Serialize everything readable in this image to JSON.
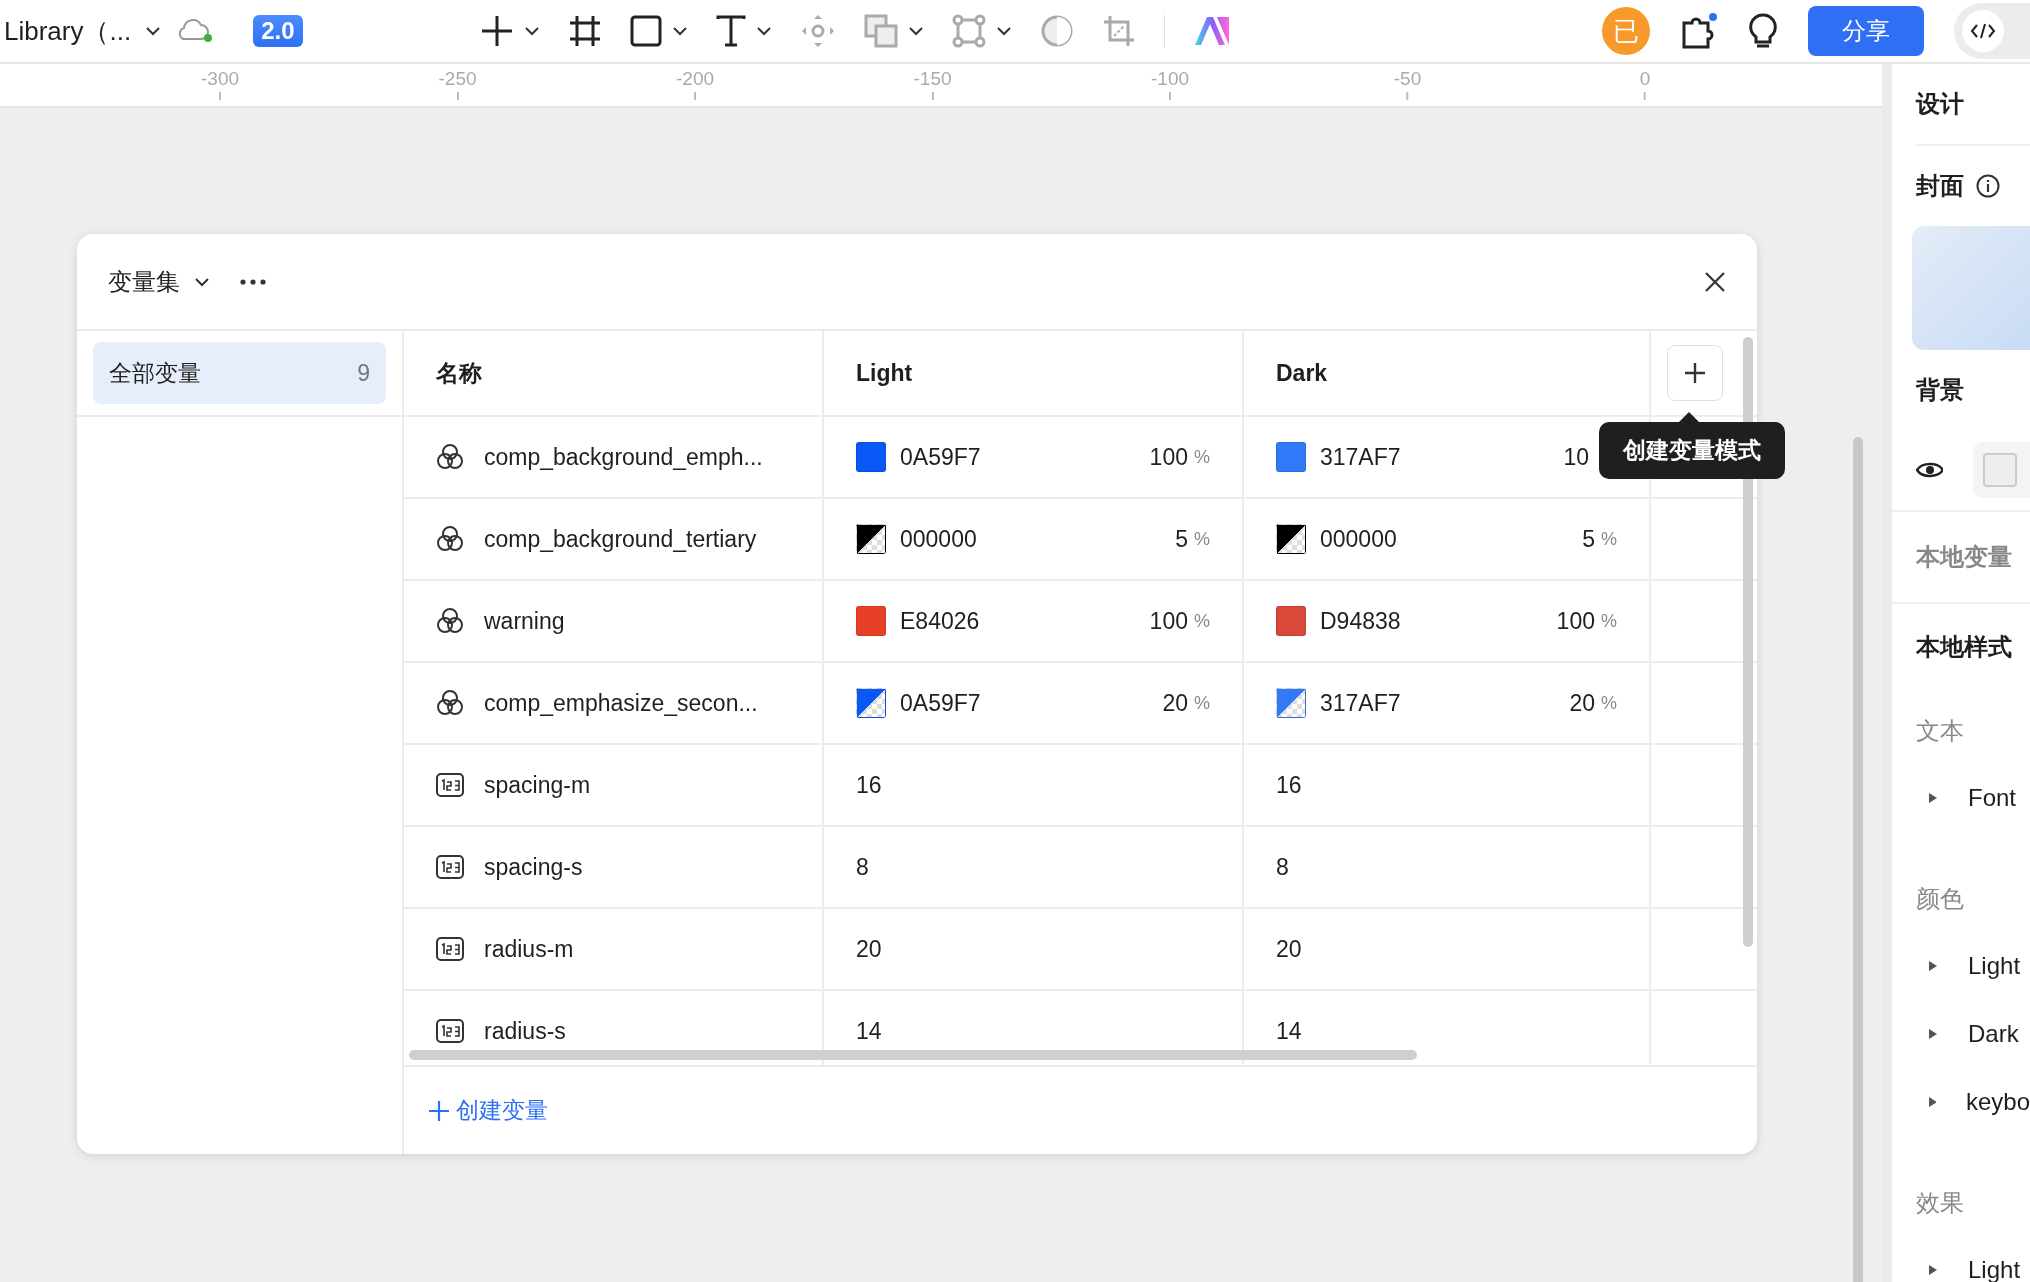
{
  "toolbar": {
    "file_title": "Library（...",
    "version_badge": "2.0",
    "avatar_text": "已",
    "share_button": "分享"
  },
  "ruler": {
    "ticks": [
      "-300",
      "-250",
      "-200",
      "-150",
      "-100",
      "-50",
      "0"
    ]
  },
  "dialog": {
    "title": "变量集",
    "collections": [
      {
        "label": "全部变量",
        "count": "9",
        "selected": true
      }
    ],
    "columns": [
      "名称",
      "Light",
      "Dark"
    ],
    "add_mode_tooltip": "创建变量模式",
    "rows": [
      {
        "kind": "color",
        "name": "comp_background_emph...",
        "values": [
          {
            "color": "#0a59f7",
            "translucent": false,
            "hex": "0A59F7",
            "opacity": "100",
            "unit": "%"
          },
          {
            "color": "#317af7",
            "translucent": false,
            "hex": "317AF7",
            "opacity": "10"
          }
        ]
      },
      {
        "kind": "color",
        "name": "comp_background_tertiary",
        "values": [
          {
            "color": "#000000",
            "translucent": true,
            "hex": "000000",
            "opacity": "5",
            "unit": "%"
          },
          {
            "color": "#000000",
            "translucent": true,
            "hex": "000000",
            "opacity": "5",
            "unit": "%"
          }
        ]
      },
      {
        "kind": "color",
        "name": "warning",
        "values": [
          {
            "color": "#e84026",
            "translucent": false,
            "hex": "E84026",
            "opacity": "100",
            "unit": "%"
          },
          {
            "color": "#d94838",
            "translucent": false,
            "hex": "D94838",
            "opacity": "100",
            "unit": "%"
          }
        ]
      },
      {
        "kind": "color",
        "name": "comp_emphasize_secon...",
        "values": [
          {
            "color": "#0a59f7",
            "translucent": true,
            "hex": "0A59F7",
            "opacity": "20",
            "unit": "%"
          },
          {
            "color": "#317af7",
            "translucent": true,
            "hex": "317AF7",
            "opacity": "20",
            "unit": "%"
          }
        ]
      },
      {
        "kind": "number",
        "name": "spacing-m",
        "values": [
          {
            "text": "16"
          },
          {
            "text": "16"
          }
        ]
      },
      {
        "kind": "number",
        "name": "spacing-s",
        "values": [
          {
            "text": "8"
          },
          {
            "text": "8"
          }
        ]
      },
      {
        "kind": "number",
        "name": "radius-m",
        "values": [
          {
            "text": "20"
          },
          {
            "text": "20"
          }
        ]
      },
      {
        "kind": "number",
        "name": "radius-s",
        "values": [
          {
            "text": "14"
          },
          {
            "text": "14"
          }
        ]
      }
    ],
    "create_button": "创建变量"
  },
  "panel": {
    "tab": "设计",
    "cover_label": "封面",
    "background_label": "背景",
    "local_variables": "本地变量",
    "local_styles": "本地样式",
    "sections": [
      {
        "title": "文本",
        "items": [
          "Font"
        ]
      },
      {
        "title": "颜色",
        "items": [
          "Light",
          "Dark",
          "keybo"
        ]
      },
      {
        "title": "效果",
        "items": [
          "Light"
        ]
      }
    ]
  }
}
